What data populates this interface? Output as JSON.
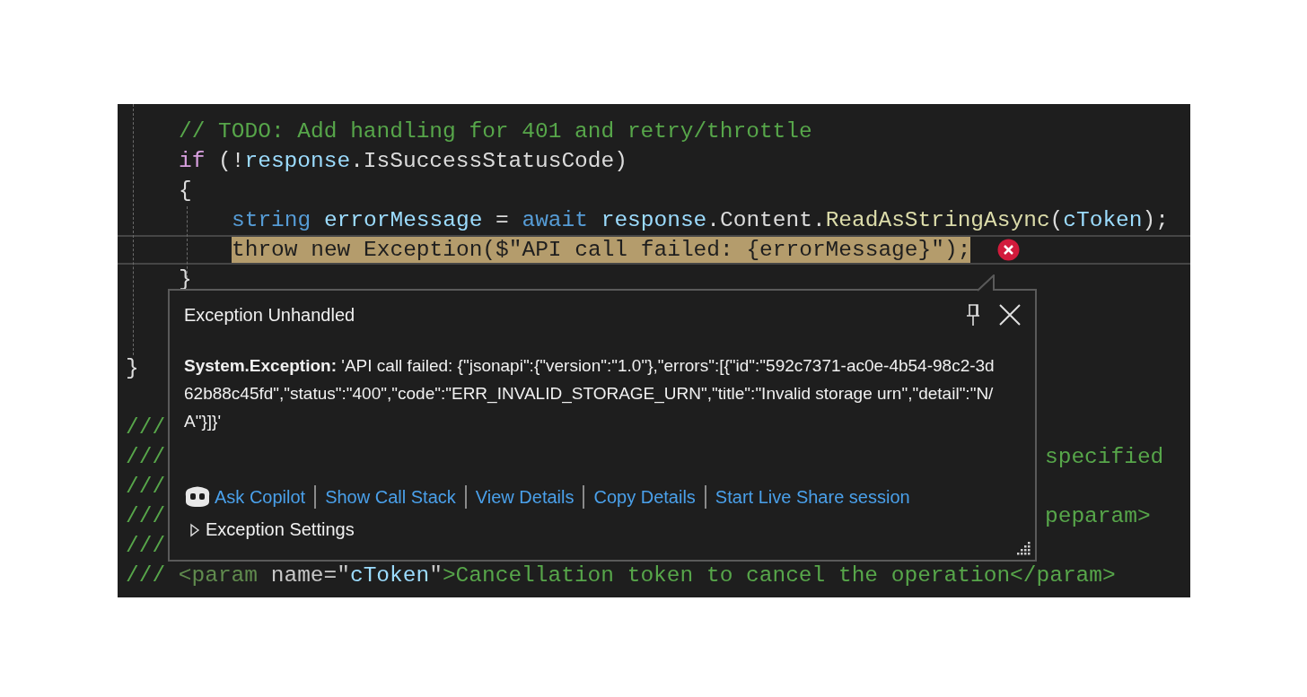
{
  "code_lines": [
    {
      "kind": "body",
      "tokens": [
        {
          "text": "// TODO: Add handling for 401 and retry/throttle",
          "kind": "comment"
        }
      ]
    },
    {
      "kind": "body",
      "tokens": [
        {
          "text": "if",
          "kind": "control"
        },
        {
          "text": " (!",
          "kind": "plain"
        },
        {
          "text": "response",
          "kind": "variable"
        },
        {
          "text": ".IsSuccessStatusCode)",
          "kind": "plain"
        }
      ]
    },
    {
      "kind": "body",
      "tokens": [
        {
          "text": "{",
          "kind": "plain"
        }
      ]
    },
    {
      "kind": "nested",
      "tokens": [
        {
          "text": "string ",
          "kind": "keyword"
        },
        {
          "text": "errorMessage",
          "kind": "variable"
        },
        {
          "text": " = ",
          "kind": "plain"
        },
        {
          "text": "await ",
          "kind": "keyword"
        },
        {
          "text": "response",
          "kind": "variable"
        },
        {
          "text": ".Content.",
          "kind": "plain"
        },
        {
          "text": "ReadAsStringAsync",
          "kind": "method"
        },
        {
          "text": "(",
          "kind": "plain"
        },
        {
          "text": "cToken",
          "kind": "variable"
        },
        {
          "text": ");",
          "kind": "plain"
        }
      ]
    },
    {
      "kind": "nested",
      "highlighted": true,
      "error": true,
      "tokens": [
        {
          "text": "throw new Exception($\"API call failed: {errorMessage}\");",
          "kind": "plain"
        }
      ]
    },
    {
      "kind": "body",
      "tokens": [
        {
          "text": "}",
          "kind": "plain"
        }
      ]
    },
    {
      "kind": "blank"
    },
    {
      "kind": "blank"
    },
    {
      "kind": "outer",
      "tokens": [
        {
          "text": "}",
          "kind": "plain"
        }
      ]
    },
    {
      "kind": "blank"
    },
    {
      "kind": "outer",
      "tokens": [
        {
          "text": "///",
          "kind": "doc"
        }
      ]
    },
    {
      "kind": "outer",
      "tokens": [
        {
          "text": "///",
          "kind": "doc"
        }
      ],
      "right": "specified"
    },
    {
      "kind": "outer",
      "tokens": [
        {
          "text": "///",
          "kind": "doc"
        }
      ]
    },
    {
      "kind": "outer",
      "tokens": [
        {
          "text": "///",
          "kind": "doc"
        }
      ],
      "right": "peparam>"
    },
    {
      "kind": "outer",
      "tokens": [
        {
          "text": "///",
          "kind": "doc"
        }
      ]
    },
    {
      "kind": "outer",
      "tokens": [
        {
          "text": "/// ",
          "kind": "doc"
        },
        {
          "text": "<param ",
          "kind": "doctag"
        },
        {
          "text": "name",
          "kind": "docattr"
        },
        {
          "text": "=\"",
          "kind": "docattr"
        },
        {
          "text": "cToken",
          "kind": "variable"
        },
        {
          "text": "\"",
          "kind": "docattr"
        },
        {
          "text": ">Cancellation token to cancel the operation</param>",
          "kind": "comment"
        }
      ]
    }
  ],
  "popup": {
    "title": "Exception Unhandled",
    "message": "**System.Exception:** 'API call failed: {\"jsonapi\":{\"version\":\"1.0\"},\"errors\":[{\"id\":\"592c7371-ac0e-4b54-98c2-3d62b88c45fd\",\"status\":\"400\",\"code\":\"ERR_INVALID_STORAGE_URN\",\"title\":\"Invalid storage urn\",\"detail\":\"N/A\"}]}'",
    "links": [
      {
        "label": "Ask Copilot",
        "kind": "copilot"
      },
      {
        "label": "Show Call Stack",
        "kind": "plain"
      },
      {
        "label": "View Details",
        "kind": "plain"
      },
      {
        "label": "Copy Details",
        "kind": "plain"
      },
      {
        "label": "Start Live Share session",
        "kind": "plain"
      }
    ],
    "settings": {
      "label": "Exception Settings",
      "expanded": false
    }
  }
}
